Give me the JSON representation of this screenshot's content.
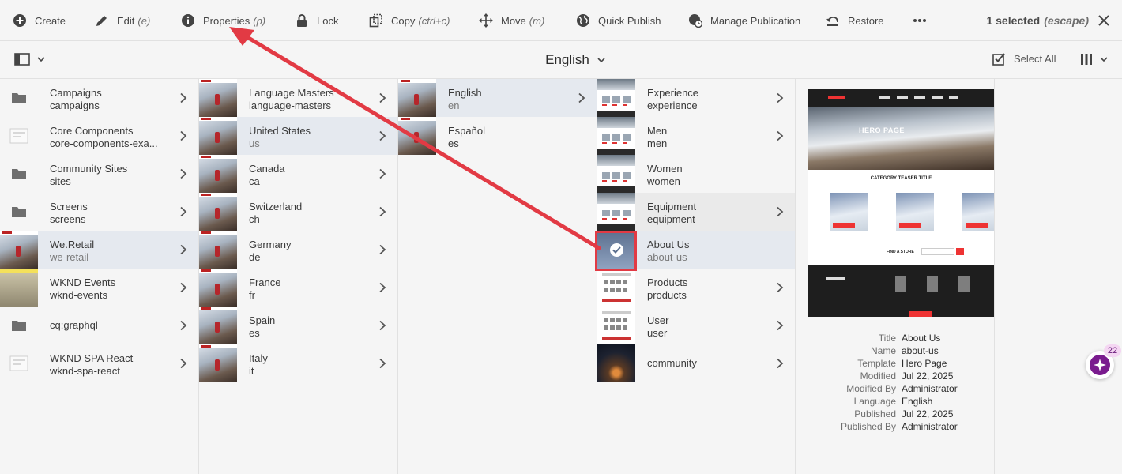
{
  "actionbar": {
    "create": "Create",
    "edit": "Edit",
    "edit_shortcut": "(e)",
    "properties": "Properties",
    "properties_shortcut": "(p)",
    "lock": "Lock",
    "copy": "Copy",
    "copy_shortcut": "(ctrl+c)",
    "move": "Move",
    "move_shortcut": "(m)",
    "quick_publish": "Quick Publish",
    "manage_publication": "Manage Publication",
    "restore": "Restore",
    "selected": "1 selected",
    "escape": "(escape)"
  },
  "header": {
    "title": "English",
    "select_all": "Select All"
  },
  "columns": [
    [
      {
        "title": "Campaigns",
        "sub": "campaigns",
        "type": "folder"
      },
      {
        "title": "Core Components",
        "sub": "core-components-exa...",
        "type": "doc"
      },
      {
        "title": "Community Sites",
        "sub": "sites",
        "type": "folder"
      },
      {
        "title": "Screens",
        "sub": "screens",
        "type": "folder"
      },
      {
        "title": "We.Retail",
        "sub": "we-retail",
        "type": "page",
        "active": true
      },
      {
        "title": "WKND Events",
        "sub": "wknd-events",
        "type": "yellow"
      },
      {
        "title": "cq:graphql",
        "sub": "",
        "type": "folder"
      },
      {
        "title": "WKND SPA React",
        "sub": "wknd-spa-react",
        "type": "doc"
      }
    ],
    [
      {
        "title": "Language Masters",
        "sub": "language-masters"
      },
      {
        "title": "United States",
        "sub": "us",
        "active": true
      },
      {
        "title": "Canada",
        "sub": "ca"
      },
      {
        "title": "Switzerland",
        "sub": "ch"
      },
      {
        "title": "Germany",
        "sub": "de"
      },
      {
        "title": "France",
        "sub": "fr"
      },
      {
        "title": "Spain",
        "sub": "es"
      },
      {
        "title": "Italy",
        "sub": "it"
      }
    ],
    [
      {
        "title": "English",
        "sub": "en",
        "active": true,
        "chevron": true
      },
      {
        "title": "Español",
        "sub": "es",
        "chevron": false
      }
    ],
    [
      {
        "title": "Experience",
        "sub": "experience",
        "type": "page2"
      },
      {
        "title": "Men",
        "sub": "men",
        "type": "page2"
      },
      {
        "title": "Women",
        "sub": "women",
        "type": "page2",
        "chevron": false
      },
      {
        "title": "Equipment",
        "sub": "equipment",
        "type": "page2",
        "hovered": true
      },
      {
        "title": "About Us",
        "sub": "about-us",
        "type": "about",
        "active": true,
        "chevron": false
      },
      {
        "title": "Products",
        "sub": "products",
        "type": "white"
      },
      {
        "title": "User",
        "sub": "user",
        "type": "white"
      },
      {
        "title": "community",
        "sub": "",
        "type": "dark"
      }
    ]
  ],
  "preview": {
    "hero_title": "HERO PAGE",
    "category_title": "CATEGORY TEASER TITLE",
    "find_store": "FIND A STORE",
    "meta": [
      {
        "label": "Title",
        "value": "About Us"
      },
      {
        "label": "Name",
        "value": "about-us"
      },
      {
        "label": "Template",
        "value": "Hero Page"
      },
      {
        "label": "Modified",
        "value": "Jul 22, 2025"
      },
      {
        "label": "Modified By",
        "value": "Administrator"
      },
      {
        "label": "Language",
        "value": "English"
      },
      {
        "label": "Published",
        "value": "Jul 22, 2025"
      },
      {
        "label": "Published By",
        "value": "Administrator"
      }
    ]
  },
  "assistant": {
    "badge": "22"
  },
  "colors": {
    "accent": "#e23a44",
    "active_row": "#e5e9ef",
    "assistant": "#7a1b8e"
  }
}
